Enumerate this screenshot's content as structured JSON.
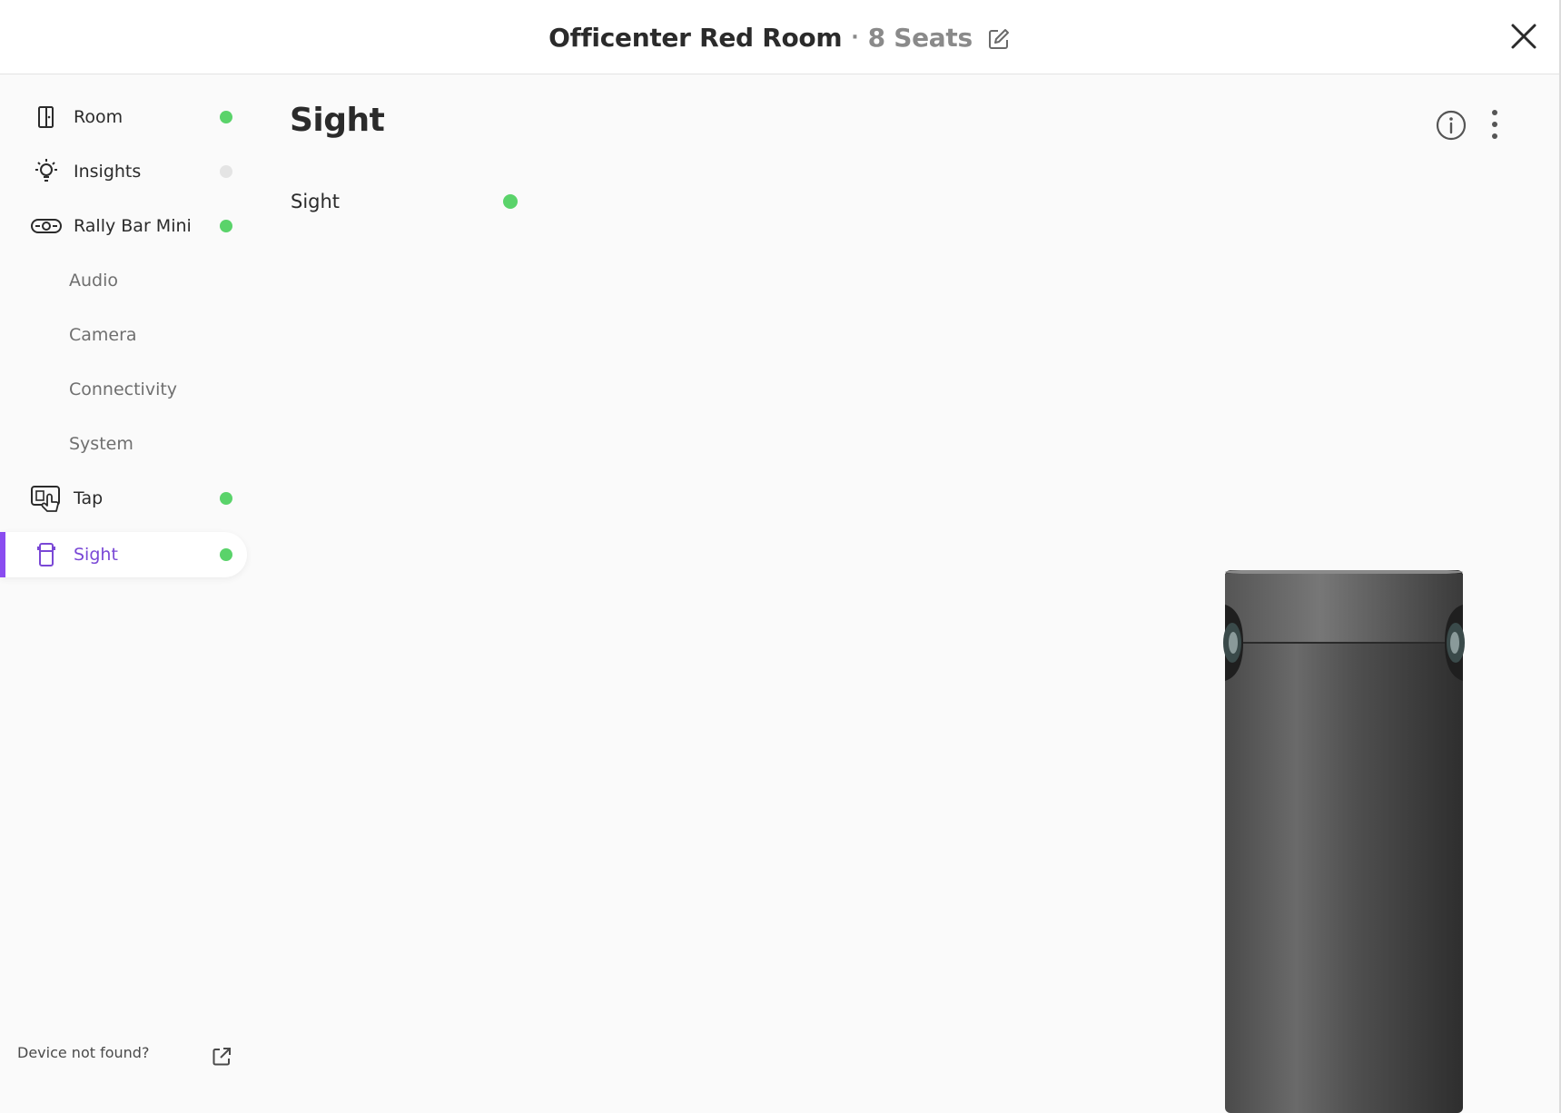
{
  "header": {
    "room_name": "Officenter Red Room",
    "separator": "·",
    "seats": "8 Seats"
  },
  "sidebar": {
    "items": [
      {
        "label": "Room",
        "icon": "door-icon",
        "status": "online"
      },
      {
        "label": "Insights",
        "icon": "lightbulb-icon",
        "status": "inactive"
      },
      {
        "label": "Rally Bar Mini",
        "icon": "rally-bar-icon",
        "status": "online"
      },
      {
        "label": "Tap",
        "icon": "touch-panel-icon",
        "status": "online"
      },
      {
        "label": "Sight",
        "icon": "sight-camera-icon",
        "status": "online",
        "active": true
      }
    ],
    "sub_items": [
      {
        "label": "Audio"
      },
      {
        "label": "Camera"
      },
      {
        "label": "Connectivity"
      },
      {
        "label": "System"
      }
    ],
    "footer": {
      "label": "Device not found?",
      "icon": "external-link-icon"
    }
  },
  "main": {
    "title": "Sight",
    "devices": [
      {
        "label": "Sight",
        "status": "online"
      }
    ]
  },
  "colors": {
    "online": "#5ad36a",
    "inactive": "#e4e4e4",
    "accent": "#8a4cf0",
    "active_text": "#7a48d6"
  }
}
